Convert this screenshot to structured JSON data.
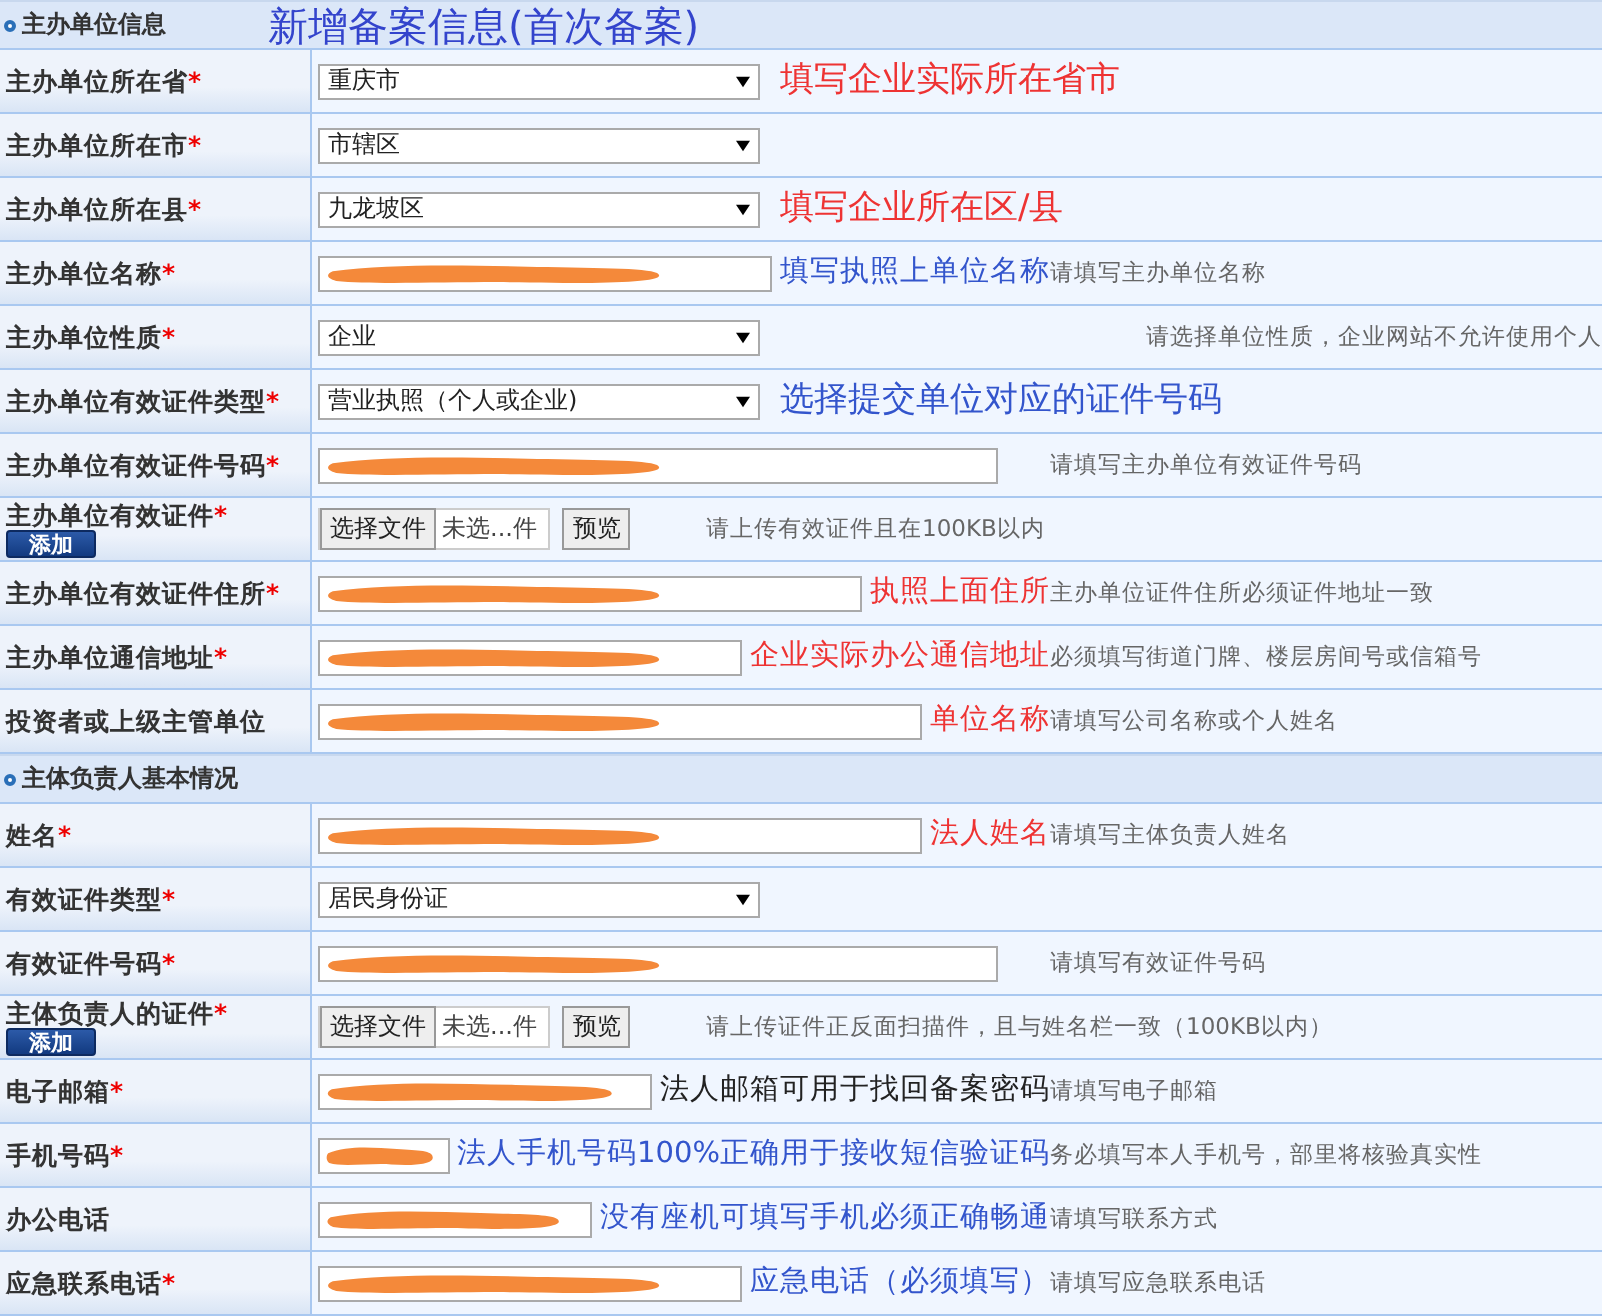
{
  "sections": [
    {
      "title": "主办单位信息",
      "annotation": {
        "text": "新增备案信息(首次备案)",
        "color": "#3344cc"
      },
      "rows": [
        {
          "label": "主办单位所在省",
          "mark": "*",
          "kind": "select",
          "value": "重庆市",
          "annotation": {
            "text": "填写企业实际所在省市",
            "color": "#ee3333"
          }
        },
        {
          "label": "主办单位所在市",
          "mark": "*",
          "kind": "select",
          "value": "市辖区"
        },
        {
          "label": "主办单位所在县",
          "mark": "*",
          "kind": "select",
          "value": "九龙坡区",
          "annotation": {
            "text": "填写企业所在区/县",
            "color": "#ee3333"
          }
        },
        {
          "label": "主办单位名称",
          "mark": "*",
          "kind": "redacted",
          "annotation": {
            "text": "填写执照上单位名称",
            "color": "#3355cc"
          },
          "hint": "请填写主办单位名称"
        },
        {
          "label": "主办单位性质",
          "mark": "*",
          "kind": "select",
          "value": "企业",
          "hint": "请选择单位性质，企业网站不允许使用个人"
        },
        {
          "label": "主办单位有效证件类型",
          "mark": "*",
          "kind": "select",
          "value": "营业执照（个人或企业)",
          "annotation": {
            "text": "选择提交单位对应的证件号码",
            "color": "#3355cc"
          }
        },
        {
          "label": "主办单位有效证件号码",
          "mark": "*",
          "kind": "redacted",
          "hint": "请填写主办单位有效证件号码"
        },
        {
          "label": "主办单位有效证件",
          "mark": "*",
          "kind": "file",
          "add": "添加",
          "choose": "选择文件",
          "file_name": "未选...件",
          "preview": "预览",
          "hint": "请上传有效证件且在100KB以内"
        },
        {
          "label": "主办单位有效证件住所",
          "mark": "*",
          "kind": "redacted",
          "annotation": {
            "text": "执照上面住所",
            "color": "#ee3333"
          },
          "hint": "主办单位证件住所必须证件地址一致"
        },
        {
          "label": "主办单位通信地址",
          "mark": "*",
          "kind": "redacted",
          "annotation": {
            "text": "企业实际办公通信地址",
            "color": "#ee3333"
          },
          "hint": "必须填写街道门牌、楼层房间号或信箱号"
        },
        {
          "label": "投资者或上级主管单位",
          "kind": "redacted",
          "annotation": {
            "text": "单位名称",
            "color": "#ee3333"
          },
          "hint": "请填写公司名称或个人姓名"
        }
      ]
    },
    {
      "title": "主体负责人基本情况",
      "rows": [
        {
          "label": "姓名",
          "mark": "*",
          "kind": "redacted",
          "annotation": {
            "text": "法人姓名",
            "color": "#ee3333"
          },
          "hint": "请填写主体负责人姓名"
        },
        {
          "label": "有效证件类型",
          "mark": "*",
          "kind": "select",
          "value": "居民身份证"
        },
        {
          "label": "有效证件号码",
          "mark": "*",
          "kind": "redacted",
          "hint": "请填写有效证件号码"
        },
        {
          "label": "主体负责人的证件",
          "mark": "*",
          "kind": "file",
          "add": "添加",
          "choose": "选择文件",
          "file_name": "未选...件",
          "preview": "预览",
          "hint": "请上传证件正反面扫描件，且与姓名栏一致（100KB以内）"
        },
        {
          "label": "电子邮箱",
          "mark": "*",
          "kind": "redacted",
          "annotation": {
            "text": "法人邮箱可用于找回备案密码",
            "color": "#222222"
          },
          "hint": "请填写电子邮箱"
        },
        {
          "label": "手机号码",
          "mark": "*",
          "kind": "redacted",
          "annotation": {
            "text": "法人手机号码100%正确用于接收短信验证码",
            "color": "#3355cc"
          },
          "hint": "务必填写本人手机号，部里将核验真实性"
        },
        {
          "label": "办公电话",
          "kind": "redacted",
          "annotation": {
            "text": "没有座机可填写手机必须正确畅通",
            "color": "#3355cc"
          },
          "hint": "请填写联系方式"
        },
        {
          "label": "应急联系电话",
          "mark": "*",
          "kind": "redacted",
          "annotation": {
            "text": "应急电话（必须填写）",
            "color": "#3355cc"
          },
          "hint": "请填写应急联系电话"
        }
      ]
    }
  ]
}
